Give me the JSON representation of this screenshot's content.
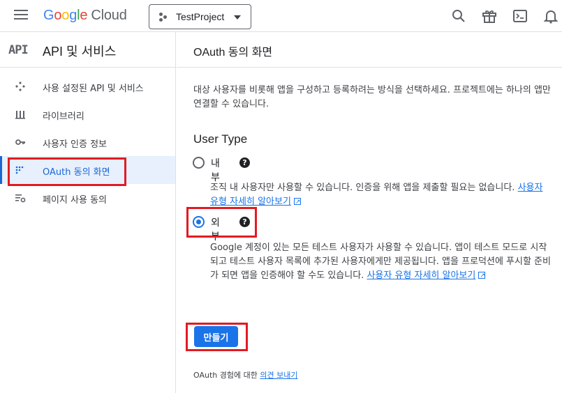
{
  "header": {
    "logo_letters": [
      "G",
      "o",
      "o",
      "g",
      "l",
      "e"
    ],
    "logo_suffix": "Cloud",
    "project_name": "TestProject",
    "icons": [
      "menu-icon",
      "search-icon",
      "gift-icon",
      "terminal-icon",
      "notifications-icon"
    ]
  },
  "sidebar": {
    "mark": "API",
    "title": "API 및 서비스",
    "items": [
      {
        "label": "사용 설정된 API 및 서비스",
        "icon": "enabled-apis-icon"
      },
      {
        "label": "라이브러리",
        "icon": "library-icon"
      },
      {
        "label": "사용자 인증 정보",
        "icon": "key-icon"
      },
      {
        "label": "OAuth 동의 화면",
        "icon": "consent-icon",
        "active": true
      },
      {
        "label": "페이지 사용 동의",
        "icon": "page-settings-icon"
      }
    ]
  },
  "main": {
    "title": "OAuth 동의 화면",
    "description": "대상 사용자를 비롯해 앱을 구성하고 등록하려는 방식을 선택하세요. 프로젝트에는 하나의 앱만 연결할 수 있습니다.",
    "user_type_label": "User Type",
    "internal": {
      "label": "내부",
      "description": "조직 내 사용자만 사용할 수 있습니다. 인증을 위해 앱을 제출할 필요는 없습니다.",
      "link": "사용자 유형 자세히 알아보기",
      "checked": false
    },
    "external": {
      "label": "외부",
      "description": "Google 계정이 있는 모든 테스트 사용자가 사용할 수 있습니다. 앱이 테스트 모드로 시작되고 테스트 사용자 목록에 추가된 사용자에게만 제공됩니다. 앱을 프로덕션에 푸시할 준비가 되면 앱을 인증해야 할 수도 있습니다.",
      "link": "사용자 유형 자세히 알아보기",
      "checked": true
    },
    "create_button": "만들기",
    "feedback_prefix": "OAuth 경험에 대한",
    "feedback_link": "의견 보내기"
  },
  "colors": {
    "accent": "#1a73e8",
    "active_bg": "#e8f0fe",
    "highlight": "#e11b22"
  }
}
